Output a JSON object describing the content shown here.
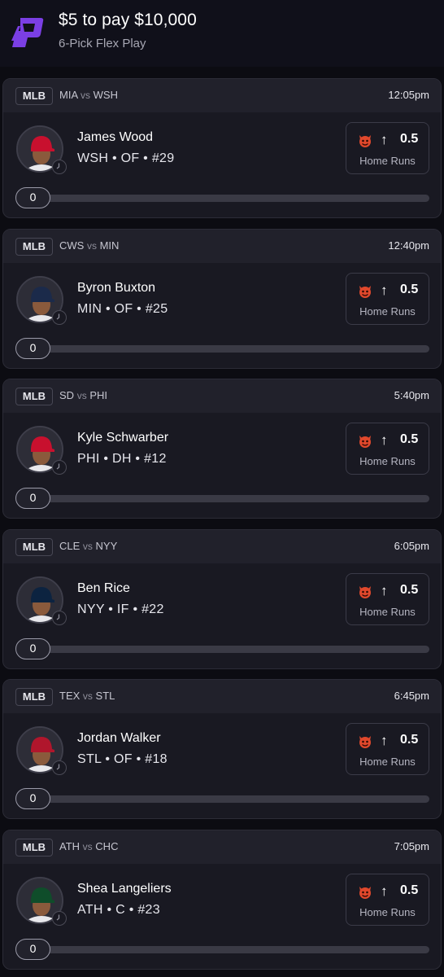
{
  "header": {
    "title": "$5 to pay $10,000",
    "subtitle": "6-Pick Flex Play",
    "brand_color": "#7b3fe4"
  },
  "picks": [
    {
      "league": "MLB",
      "away": "MIA",
      "vs": "vs",
      "home": "WSH",
      "time": "12:05pm",
      "player": "James Wood",
      "info": "WSH • OF • #29",
      "direction_icon": "arrow-up",
      "line": "0.5",
      "stat": "Home Runs",
      "progress": "0",
      "cap_color": "#c8102e"
    },
    {
      "league": "MLB",
      "away": "CWS",
      "vs": "vs",
      "home": "MIN",
      "time": "12:40pm",
      "player": "Byron Buxton",
      "info": "MIN • OF • #25",
      "direction_icon": "arrow-up",
      "line": "0.5",
      "stat": "Home Runs",
      "progress": "0",
      "cap_color": "#1b2a4a"
    },
    {
      "league": "MLB",
      "away": "SD",
      "vs": "vs",
      "home": "PHI",
      "time": "5:40pm",
      "player": "Kyle Schwarber",
      "info": "PHI • DH • #12",
      "direction_icon": "arrow-up",
      "line": "0.5",
      "stat": "Home Runs",
      "progress": "0",
      "cap_color": "#c8102e"
    },
    {
      "league": "MLB",
      "away": "CLE",
      "vs": "vs",
      "home": "NYY",
      "time": "6:05pm",
      "player": "Ben Rice",
      "info": "NYY • IF • #22",
      "direction_icon": "arrow-up",
      "line": "0.5",
      "stat": "Home Runs",
      "progress": "0",
      "cap_color": "#0c2340"
    },
    {
      "league": "MLB",
      "away": "TEX",
      "vs": "vs",
      "home": "STL",
      "time": "6:45pm",
      "player": "Jordan Walker",
      "info": "STL • OF • #18",
      "direction_icon": "arrow-up",
      "line": "0.5",
      "stat": "Home Runs",
      "progress": "0",
      "cap_color": "#b0162c"
    },
    {
      "league": "MLB",
      "away": "ATH",
      "vs": "vs",
      "home": "CHC",
      "time": "7:05pm",
      "player": "Shea Langeliers",
      "info": "ATH • C • #23",
      "direction_icon": "arrow-up",
      "line": "0.5",
      "stat": "Home Runs",
      "progress": "0",
      "cap_color": "#0f4d2a"
    }
  ]
}
